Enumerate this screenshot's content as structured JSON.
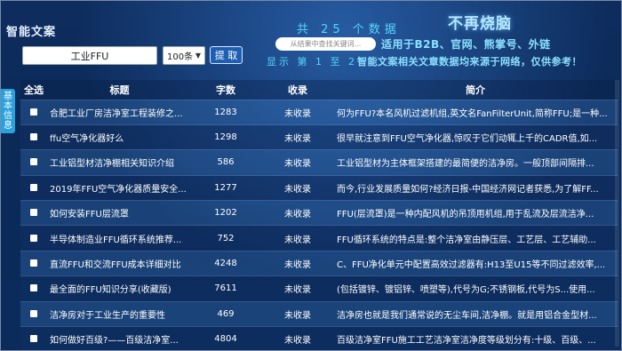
{
  "app": {
    "title": "智能文案"
  },
  "search": {
    "value": "工业FFU",
    "page_size": "100条",
    "button_label": "提 取",
    "hint_placeholder": "从结果中查找关键词..."
  },
  "header": {
    "count_text": "共 25 个数据",
    "tagline": "不再烧脑",
    "promo": "适用于B2B、官网、熊掌号、外链",
    "summary_prefix": "显示 第 1 至 2",
    "summary_highlight": "智能文案相关文章数据均来源于网络，仅供参考！"
  },
  "side_tab": {
    "label": "基本信息"
  },
  "table": {
    "columns": {
      "select_all": "全选",
      "title": "标题",
      "count": "字数",
      "status": "收录",
      "summary": "简介"
    },
    "rows": [
      {
        "title": "合肥工业厂房洁净室工程装修之...",
        "count": "1283",
        "status": "未收录",
        "summary": "何为FFU?本名风机过滤机组,英文名FanFilterUnit,简称FFU;是一种..."
      },
      {
        "title": "ffu空气净化器好么",
        "count": "1298",
        "status": "未收录",
        "summary": "很早就注意到FFU空气净化器,惊叹于它们动辄上千的CADR值,如..."
      },
      {
        "title": "工业铝型材洁净棚相关知识介绍",
        "count": "586",
        "status": "未收录",
        "summary": "工业铝型材为主体框架搭建的最简便的洁净房。一般顶部间隔排..."
      },
      {
        "title": "2019年FFU空气净化器质量安全...",
        "count": "1277",
        "status": "未收录",
        "summary": "而今,行业发展质量如何?经济日报-中国经济网记者获悉,为了解FF..."
      },
      {
        "title": "如何安装FFU层流罩",
        "count": "1202",
        "status": "未收录",
        "summary": "FFU(层流罩)是一种内配风机的吊顶用机组,用于乱流及层流洁净..."
      },
      {
        "title": "半导体制造业FFU循环系统推荐...",
        "count": "752",
        "status": "未收录",
        "summary": "FFU循环系统的特点是:整个洁净室由静压层、工艺层、工艺辅助..."
      },
      {
        "title": "直流FFU和交流FFU成本详细对比",
        "count": "4248",
        "status": "未收录",
        "summary": "C、FFU净化单元中配置高效过滤器有:H13至U15等不同过滤效率,..."
      },
      {
        "title": "最全面的FFU知识分享(收藏版)",
        "count": "7611",
        "status": "未收录",
        "summary": "(包括镀锌、镀铝锌、喷塑等),代号为G;不锈钢板,代号为S...使用..."
      },
      {
        "title": "洁净房对于工业生产的重要性",
        "count": "469",
        "status": "未收录",
        "summary": "洁净房也就是我们通常说的无尘车间,洁净棚。就是用铝合金型材..."
      },
      {
        "title": "如何做好百级?——百级洁净室...",
        "count": "4804",
        "status": "未收录",
        "summary": "百级洁净室FFU施工工艺洁净室洁净度等级划分有:十级、百级、..."
      }
    ]
  },
  "colors": {
    "background": "#0c2550",
    "accent": "#55d7ff",
    "button": "#1d5fb3",
    "side_tab": "#2aa1dc"
  }
}
